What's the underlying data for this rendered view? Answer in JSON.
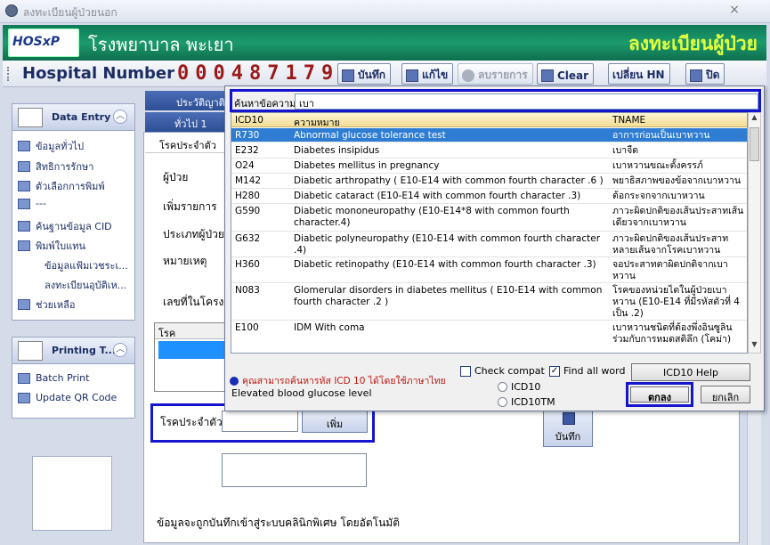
{
  "window": {
    "title": "ลงทะเบียนผู้ป่วยนอก",
    "close": "×"
  },
  "banner": {
    "logo": "HOSxP",
    "hospital": "โรงพยาบาล พะเยา",
    "page_title": "ลงทะเบียนผู้ป่วย"
  },
  "toolbar": {
    "hn_label": "Hospital Number",
    "hn_value": "000487179",
    "buttons": {
      "save": "บันทึก",
      "edit": "แก้ไข",
      "delete": "ลบรายการ",
      "clear": "Clear",
      "change_hn": "เปลี่ยน HN",
      "close": "ปิด"
    }
  },
  "sidebar": {
    "data_entry": {
      "title": "Data Entry",
      "items": [
        "ข้อมูลทั่วไป",
        "สิทธิการรักษา",
        "ตัวเลือกการพิมพ์",
        "---",
        "ค้นฐานข้อมูล CID",
        "พิมพ์ใบแทน",
        "ข้อมูลแฟ้มเวชระเ...",
        "ลงทะเบียนอุบัติเห...",
        "ช่วยเหลือ"
      ]
    },
    "printing": {
      "title": "Printing T...",
      "items": [
        "Batch Print",
        "Update QR Code"
      ]
    }
  },
  "form": {
    "tabs": {
      "history": "ประวัติญาติ",
      "general": "ทั่วไป 1",
      "congenital_tab": "โรคประจำตัว"
    },
    "labels": {
      "patient": "ผู้ป่วย",
      "add_item": "เพิ่มรายการ",
      "patient_type": "ประเภทผู้ป่วย",
      "note": "หมายเหตุ",
      "project_no": "เลขที่ในโครงก"
    },
    "grid_header": "โรค",
    "congenital_label": "โรคประจำตัว",
    "add_button": "เพิ่ม",
    "save_button": "บันทึก",
    "footer_note": "ข้อมูลจะถูกบันทึกเข้าสู่ระบบคลินิกพิเศษ โดยอัตโนมัติ"
  },
  "popup": {
    "search_label": "ค้นหาข้อความ",
    "search_value": "เบา",
    "columns": [
      "ICD10",
      "ความหมาย",
      "TNAME"
    ],
    "rows": [
      {
        "code": "R730",
        "meaning": "Abnormal glucose tolerance test",
        "tname": "อาการก่อนเป็นเบาหวาน",
        "selected": true
      },
      {
        "code": "E232",
        "meaning": "Diabetes insipidus",
        "tname": "เบาจืด"
      },
      {
        "code": "O24",
        "meaning": "Diabetes mellitus in pregnancy",
        "tname": "เบาหวานขณะตั้งครรภ์"
      },
      {
        "code": "M142",
        "meaning": "Diabetic arthropathy ( E10-E14 with common fourth character .6 )",
        "tname": "พยาธิสภาพของข้อจากเบาหวาน"
      },
      {
        "code": "H280",
        "meaning": "Diabetic cataract (E10-E14 with common fourth character .3)",
        "tname": "ต้อกระจกจากเบาหวาน"
      },
      {
        "code": "G590",
        "meaning": "Diabetic mononeuropathy (E10-E14*8 with common fourth character.4)",
        "tname": "ภาวะผิดปกติของเส้นประสาทเส้นเดียวจากเบาหวาน"
      },
      {
        "code": "G632",
        "meaning": "Diabetic polyneuropathy (E10-E14 with common fourth character .4)",
        "tname": "ภาวะผิดปกติของเส้นประสาทหลายเส้นจากโรคเบาหวาน"
      },
      {
        "code": "H360",
        "meaning": "Diabetic retinopathy (E10-E14 with common fourth character .3)",
        "tname": "จอประสาทตาผิดปกติจากเบาหวาน"
      },
      {
        "code": "N083",
        "meaning": "Glomerular disorders in diabetes mellitus ( E10-E14 with common fourth character .2 )",
        "tname": "โรคของหน่วยไตในผู้ป่วยเบาหวาน (E10-E14 ที่มีรหัสตัวที่ 4 เป็น .2)"
      },
      {
        "code": "E100",
        "meaning": "IDM With coma",
        "tname": "เบาหวานชนิดที่ต้องพึ่งอินซูลินร่วมกับการหมดสติลึก (โคม่า)"
      }
    ],
    "note": "คุณสามารถค้นหารหัส ICD 10 ได้โดยใช้ภาษาไทย",
    "description": "Elevated blood glucose level",
    "check_compat": "Check compat",
    "find_all_word": "Find all word",
    "radio_icd10": "ICD10",
    "radio_icd10tm": "ICD10TM",
    "help_button": "ICD10 Help",
    "ok_button": "ตกลง",
    "cancel_button": "ยกเลิก"
  }
}
